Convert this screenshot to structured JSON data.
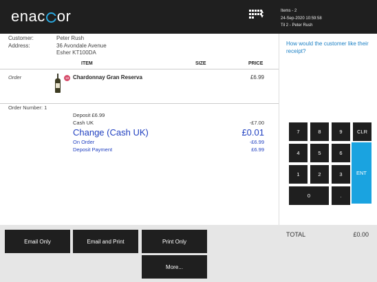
{
  "header": {
    "brand_pre": "enac",
    "brand_post": "or",
    "info": [
      "Items - 2",
      "24-Sep-2020 10:59:58",
      "Til 2 - Peter Rush"
    ]
  },
  "customer": {
    "customer_label": "Customer:",
    "customer_name": "Peter Rush",
    "address_label": "Address:",
    "address_line1": "36 Avondale Avenue",
    "address_line2": "Esher KT100DA"
  },
  "receipt_question": "How would the customer like their receipt?",
  "columns": {
    "item": "ITEM",
    "size": "SIZE",
    "price": "PRICE"
  },
  "order": {
    "label": "Order",
    "item_tag": "18",
    "item_name": "Chardonnay Gran Reserva",
    "item_price": "£6.99"
  },
  "summary": {
    "order_number": "Order Number: 1",
    "deposit_label": "Deposit £6.99",
    "cash_label": "Cash UK",
    "cash_value": "-£7.00",
    "change_label": "Change (Cash UK)",
    "change_value": "£0.01",
    "on_order_label": "On Order",
    "on_order_value": "-£6.99",
    "deposit_payment_label": "Deposit Payment",
    "deposit_payment_value": "£6.99"
  },
  "keypad": {
    "k7": "7",
    "k8": "8",
    "k9": "9",
    "clr": "CLR",
    "k4": "4",
    "k5": "5",
    "k6": "6",
    "k1": "1",
    "k2": "2",
    "k3": "3",
    "ent": "ENT",
    "k0": "0",
    "dot": "."
  },
  "footer": {
    "email_only": "Email Only",
    "email_and_print": "Email and Print",
    "print_only": "Print Only",
    "more": "More...",
    "total_label": "TOTAL",
    "total_value": "£0.00"
  },
  "colors": {
    "accent": "#1aa3e0",
    "header_bg": "#1f1f1f",
    "link": "#1a7fc4",
    "change": "#1f3fc0"
  }
}
